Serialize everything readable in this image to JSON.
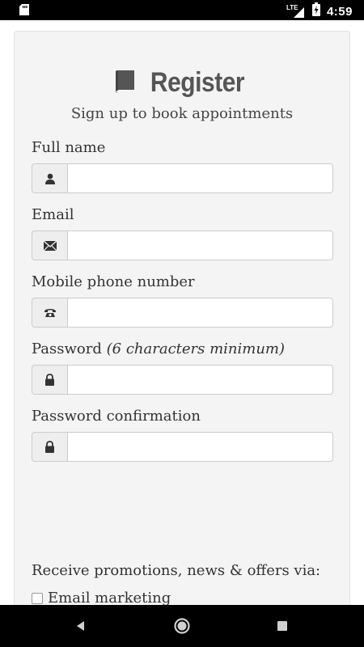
{
  "status_bar": {
    "network": "LTE",
    "time": "4:59"
  },
  "header": {
    "title": "Register",
    "subtitle": "Sign up to book appointments"
  },
  "form": {
    "full_name": {
      "label": "Full name",
      "value": "",
      "icon": "user-icon"
    },
    "email": {
      "label": "Email",
      "value": "",
      "icon": "envelope-icon"
    },
    "mobile": {
      "label": "Mobile phone number",
      "value": "",
      "icon": "phone-icon"
    },
    "password": {
      "label": "Password",
      "hint": "(6 characters minimum)",
      "value": "",
      "icon": "lock-icon"
    },
    "password_confirmation": {
      "label": "Password confirmation",
      "value": "",
      "icon": "lock-icon"
    }
  },
  "promotions": {
    "label": "Receive promotions, news & offers via:",
    "options": [
      {
        "label": "Email marketing",
        "checked": false
      }
    ]
  },
  "colors": {
    "card_bg": "#f4f4f4",
    "text": "#333333",
    "title": "#555555"
  }
}
